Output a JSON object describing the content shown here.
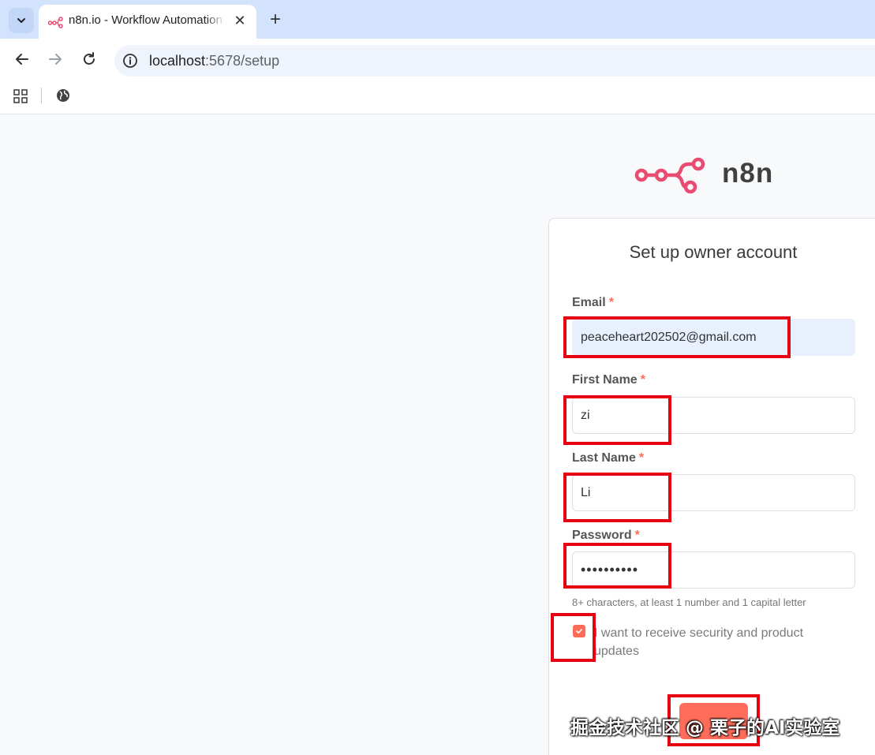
{
  "browser": {
    "tab_title": "n8n.io - Workflow Automation",
    "url_host": "localhost",
    "url_path": ":5678/setup"
  },
  "logo": {
    "text": "n8n",
    "accent_color": "#ea4b71"
  },
  "form": {
    "title": "Set up owner account",
    "email": {
      "label": "Email",
      "required_mark": "*",
      "value": "peaceheart202502@gmail.com"
    },
    "first_name": {
      "label": "First Name",
      "required_mark": "*",
      "value": "zi"
    },
    "last_name": {
      "label": "Last Name",
      "required_mark": "*",
      "value": "Li"
    },
    "password": {
      "label": "Password",
      "required_mark": "*",
      "value": "••••••••••",
      "hint": "8+ characters, at least 1 number and 1 capital letter"
    },
    "updates_checkbox": {
      "label": "I want to receive security and product updates",
      "checked": true
    },
    "submit_color": "#ff6d5a"
  },
  "watermark": "掘金技术社区 @ 栗子的AI实验室",
  "colors": {
    "tabstrip": "#d3e3fd",
    "annotation": "#e60012",
    "primary": "#ff6d5a"
  }
}
